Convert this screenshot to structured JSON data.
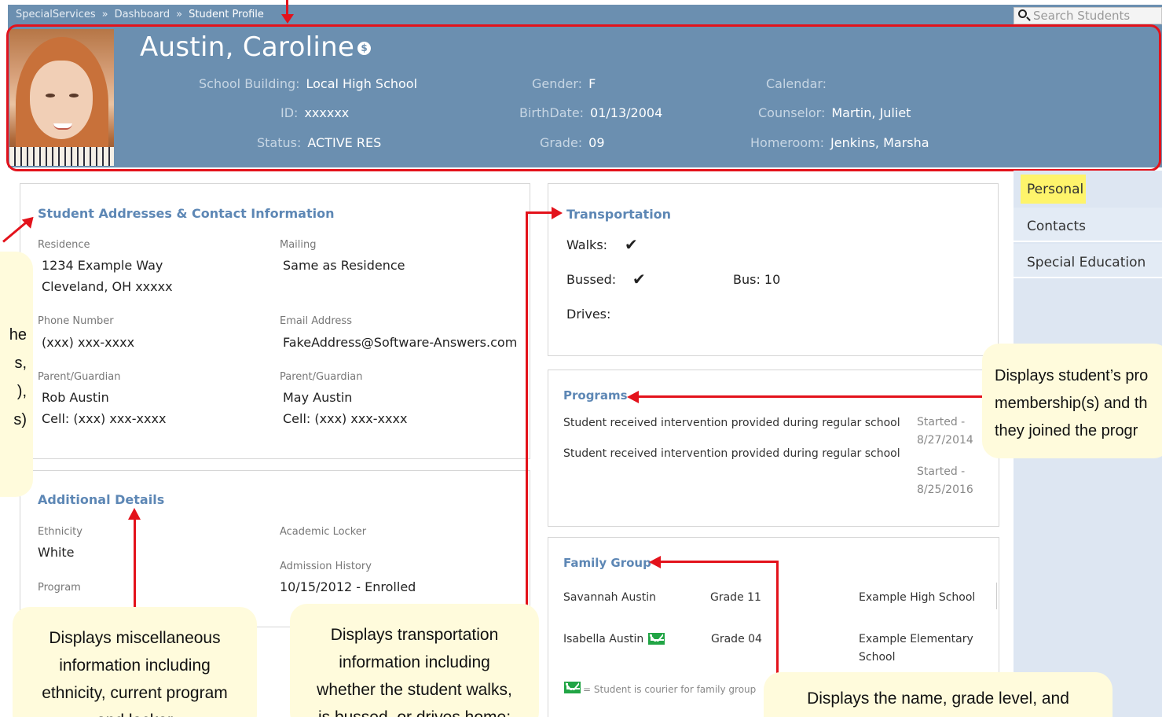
{
  "nav": {
    "breadcrumbs": [
      "SpecialServices",
      "Dashboard",
      "Student Profile"
    ],
    "separator": "»",
    "search_placeholder": "Search Students"
  },
  "student": {
    "name": "Austin, Caroline",
    "badge_icon": "dollar-icon",
    "fields": {
      "school_building": {
        "label": "School Building:",
        "value": "Local High School"
      },
      "id": {
        "label": "ID:",
        "value": "xxxxxx"
      },
      "status": {
        "label": "Status:",
        "value": "ACTIVE RES"
      },
      "gender": {
        "label": "Gender:",
        "value": "F"
      },
      "birthdate": {
        "label": "BirthDate:",
        "value": "01/13/2004"
      },
      "grade": {
        "label": "Grade:",
        "value": "09"
      },
      "calendar": {
        "label": "Calendar:",
        "value": ""
      },
      "counselor": {
        "label": "Counselor:",
        "value": "Martin, Juliet"
      },
      "homeroom": {
        "label": "Homeroom:",
        "value": "Jenkins, Marsha"
      }
    }
  },
  "contact": {
    "title": "Student Addresses & Contact Information",
    "residence": {
      "label": "Residence",
      "line1": "1234 Example Way",
      "line2": "Cleveland, OH xxxxx"
    },
    "mailing": {
      "label": "Mailing",
      "value": "Same as Residence"
    },
    "phone": {
      "label": "Phone Number",
      "value": "(xxx) xxx-xxxx"
    },
    "email": {
      "label": "Email Address",
      "value": "FakeAddress@Software-Answers.com"
    },
    "guardian1": {
      "label": "Parent/Guardian",
      "name": "Rob Austin",
      "cell": "Cell: (xxx) xxx-xxxx"
    },
    "guardian2": {
      "label": "Parent/Guardian",
      "name": "May Austin",
      "cell": "Cell: (xxx) xxx-xxxx"
    }
  },
  "additional": {
    "title": "Additional Details",
    "ethnicity": {
      "label": "Ethnicity",
      "value": "White"
    },
    "program": {
      "label": "Program",
      "value": ""
    },
    "locker": {
      "label": "Academic Locker",
      "value": ""
    },
    "admission": {
      "label": "Admission History",
      "value": "10/15/2012 - Enrolled"
    }
  },
  "transportation": {
    "title": "Transportation",
    "walks": "Walks:",
    "bussed": "Bussed:",
    "drives": "Drives:",
    "bus": "Bus: 10"
  },
  "programs": {
    "title": "Programs",
    "items": [
      {
        "name": "Student received intervention provided during regular school",
        "started": "Started -",
        "date": "8/27/2014"
      },
      {
        "name": "Student received intervention provided during regular school",
        "started": "Started -",
        "date": "8/25/2016"
      }
    ]
  },
  "family": {
    "title": "Family Group",
    "members": [
      {
        "name": "Savannah Austin",
        "grade": "Grade 11",
        "school": "Example High School"
      },
      {
        "name": "Isabella Austin",
        "grade": "Grade 04",
        "school_line1": "Example Elementary",
        "school_line2": "School"
      }
    ],
    "legend": "= Student is courier for family group"
  },
  "side_nav": {
    "selected": "Personal",
    "items": [
      "Contacts",
      "Special Education"
    ]
  },
  "callouts": {
    "left_fragment": [
      "he",
      "s,",
      "),",
      "",
      "s)"
    ],
    "programs": [
      "Displays student’s pro",
      "membership(s) and th",
      "they joined the progr"
    ],
    "additional": [
      "Displays miscellaneous",
      "information including",
      "ethnicity, current program",
      "and locker"
    ],
    "transportation": [
      "Displays transportation",
      "information including",
      "whether the student walks,",
      "is bussed, or drives home;"
    ],
    "family": [
      "Displays the name, grade level, and"
    ]
  },
  "colors": {
    "header_bg": "#6b8fb0",
    "section_title": "#5d87b5",
    "annotation_red": "#e3121b",
    "callout_bg": "#fffbdc",
    "selected_tab": "#fef46b"
  }
}
